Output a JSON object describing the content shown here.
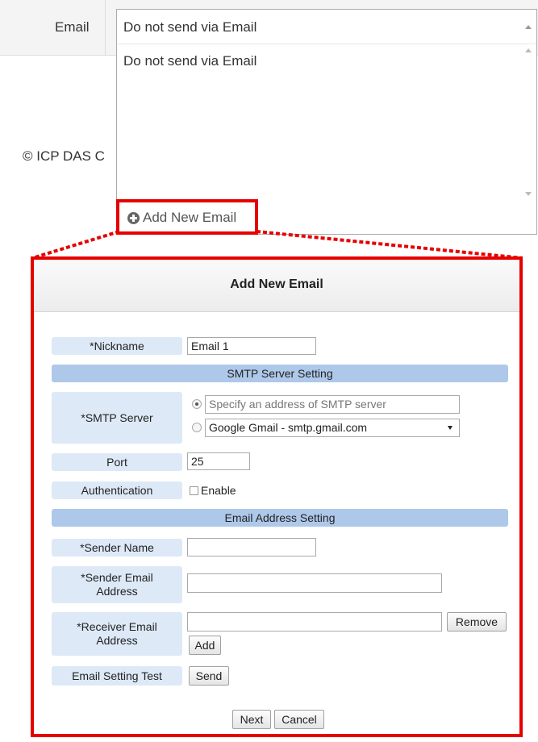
{
  "page": {
    "email_label": "Email",
    "copyright_text": "© ICP DAS C",
    "email_select": {
      "current_value": "Do not send via Email",
      "options": [
        "Do not send via Email"
      ]
    },
    "add_email_link": "Add New Email"
  },
  "dialog": {
    "title": "Add New Email",
    "nickname": {
      "label": "*Nickname",
      "value": "Email 1"
    },
    "smtp_section_title": "SMTP Server Setting",
    "smtp_server": {
      "label": "*SMTP Server",
      "address_placeholder": "Specify an address of SMTP server",
      "preset_value": "Google Gmail - smtp.gmail.com"
    },
    "port": {
      "label": "Port",
      "value": "25"
    },
    "authentication": {
      "label": "Authentication",
      "checkbox_label": "Enable",
      "checked": false
    },
    "email_section_title": "Email Address Setting",
    "sender_name": {
      "label": "*Sender Name",
      "value": ""
    },
    "sender_email": {
      "label_line1": "*Sender Email",
      "label_line2": "Address",
      "value": ""
    },
    "receiver_email": {
      "label_line1": "*Receiver Email",
      "label_line2": "Address",
      "value": "",
      "remove_label": "Remove",
      "add_label": "Add"
    },
    "test": {
      "label": "Email Setting Test",
      "send_label": "Send"
    },
    "footer": {
      "next_label": "Next",
      "cancel_label": "Cancel"
    }
  },
  "colors": {
    "highlight": "#e60000",
    "label_bg": "#dde9f7",
    "section_bg": "#aec8ea"
  }
}
